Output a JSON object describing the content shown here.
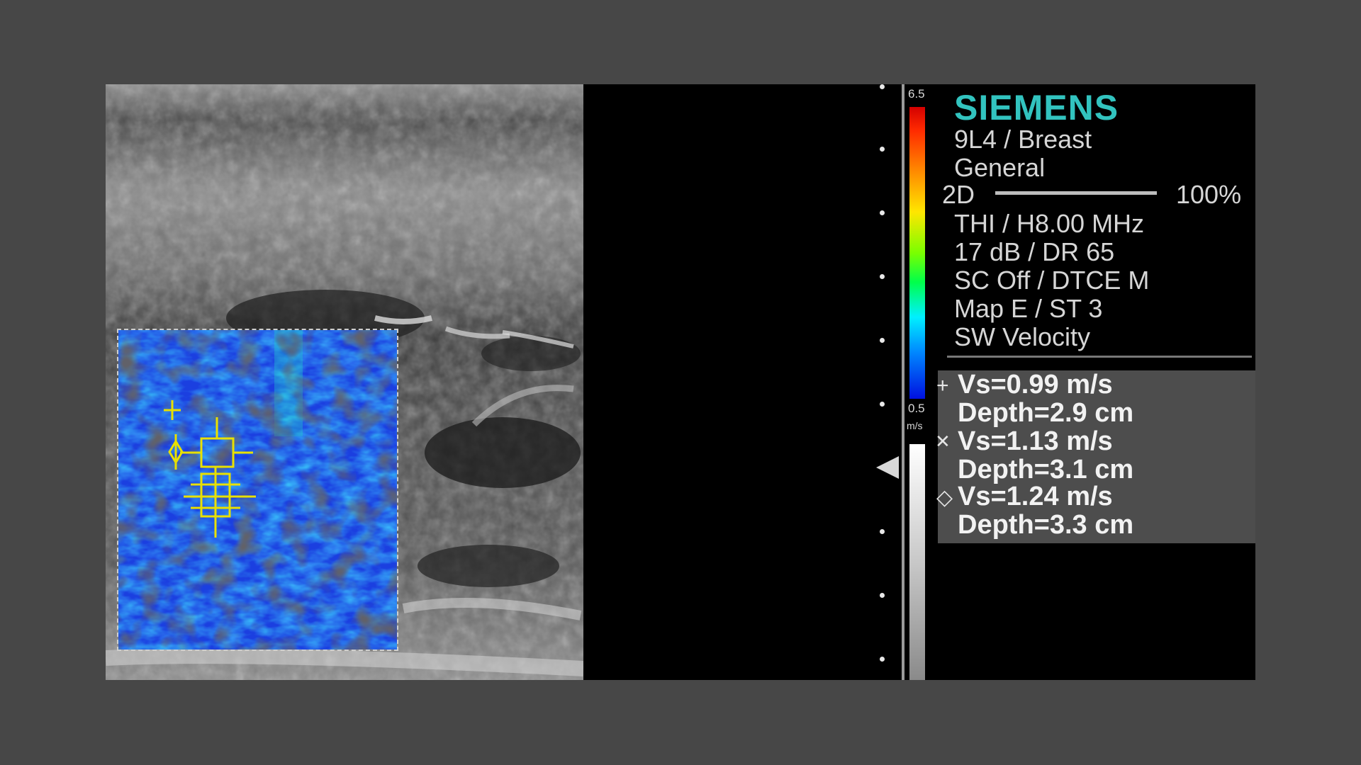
{
  "scanner": {
    "brand": "SIEMENS",
    "transducer": "9L4 / Breast",
    "preset": "General",
    "mode": "2D",
    "mode_percent": "100%",
    "frequency": "THI / H8.00 MHz",
    "gain_dr": "17 dB / DR 65",
    "compounding": "SC Off / DTCE M",
    "map": "Map E / ST 3",
    "display_mode": "SW Velocity"
  },
  "scale": {
    "color_top": "6.5",
    "color_bottom": "0.5",
    "gray_top": "m/s"
  },
  "measurements": [
    {
      "icon": "crosshair-icon",
      "symbol": "+",
      "velocity": "Vs=0.99 m/s",
      "depth": "Depth=2.9 cm"
    },
    {
      "icon": "x-cross-icon",
      "symbol": "✕",
      "velocity": "Vs=1.13 m/s",
      "depth": "Depth=3.1 cm"
    },
    {
      "icon": "diamond-icon",
      "symbol": "◇",
      "velocity": "Vs=1.24 m/s",
      "depth": "Depth=3.3 cm"
    }
  ],
  "colors": {
    "brand": "#32c3bf",
    "roi_outline": "#cfcfcf",
    "marker": "#e8e000"
  }
}
